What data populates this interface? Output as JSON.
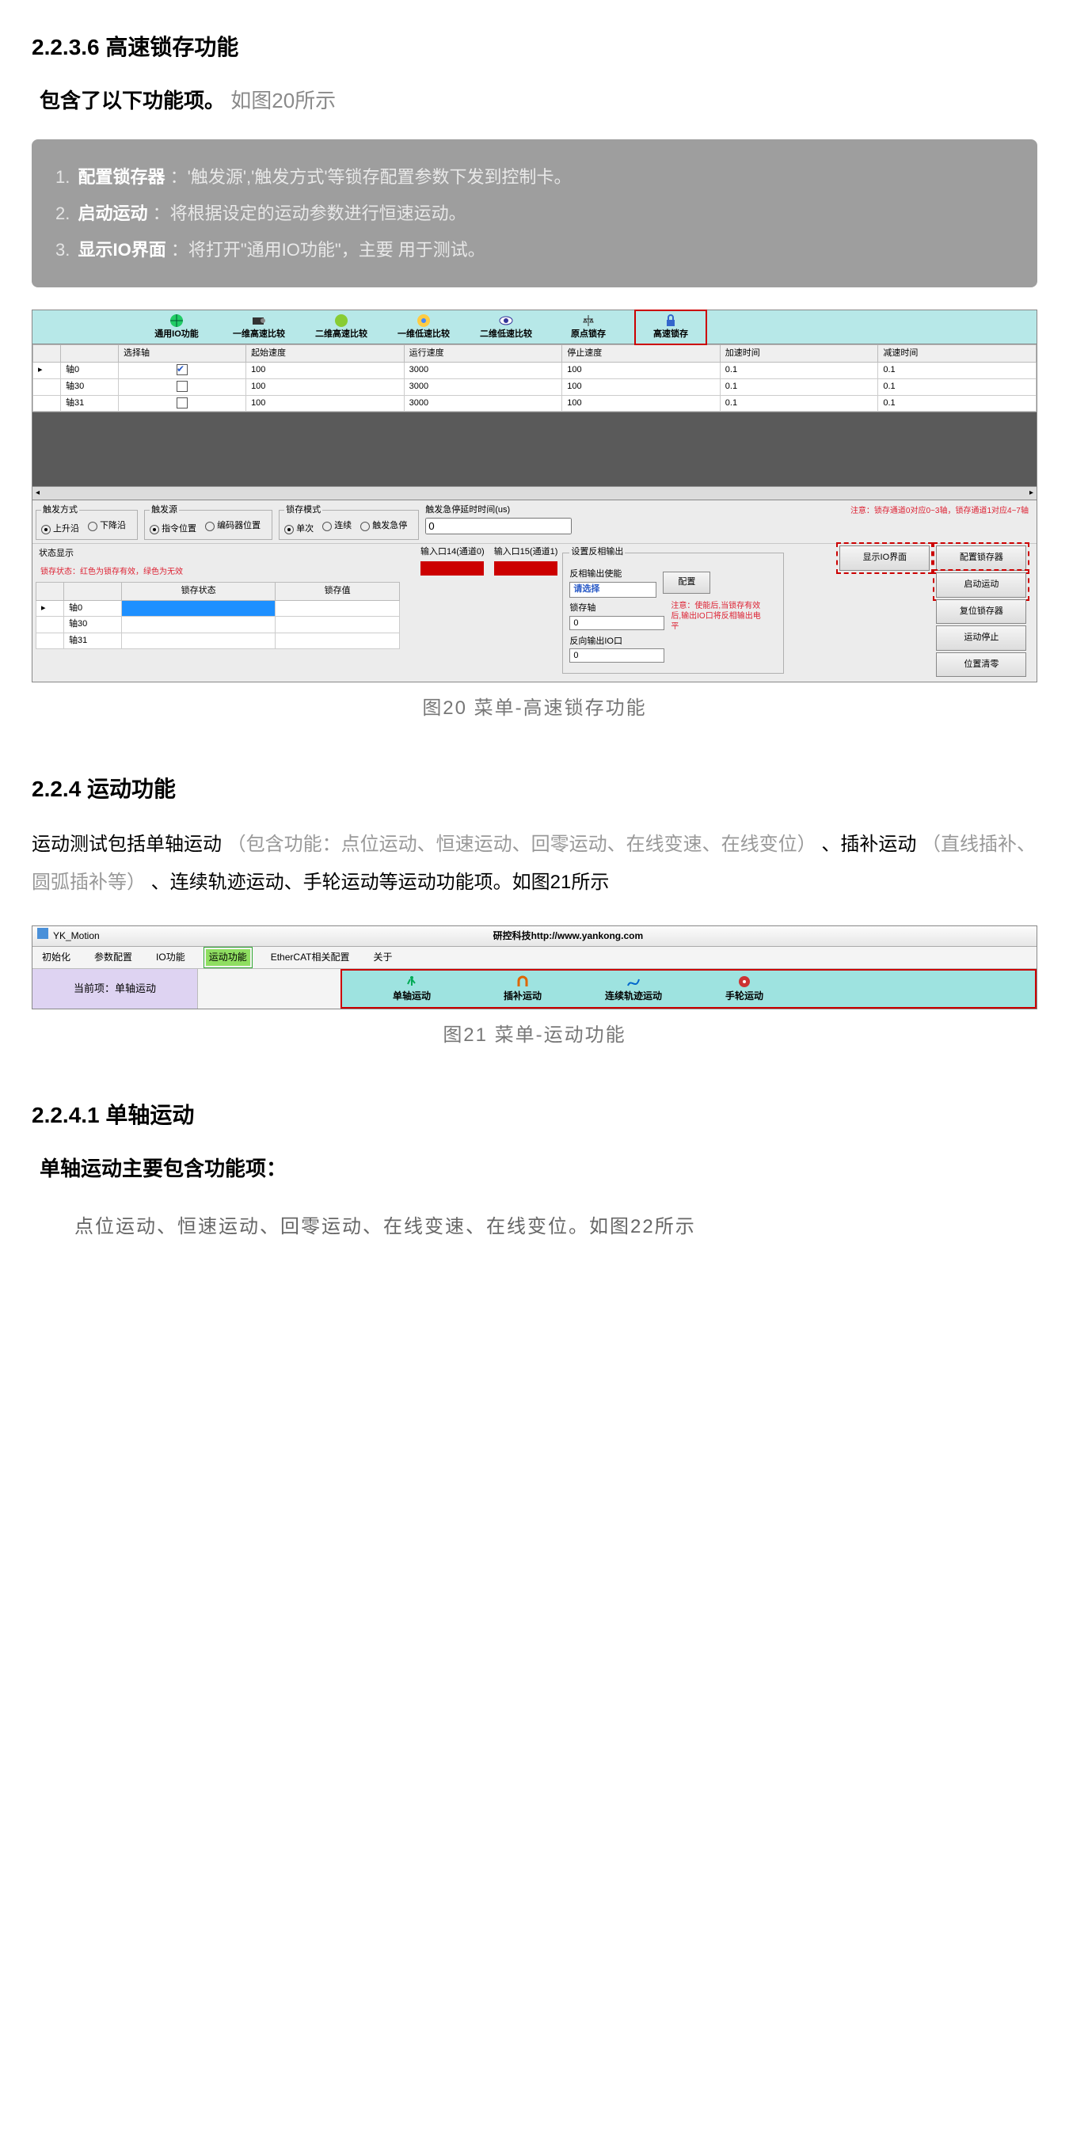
{
  "s2236": {
    "heading": "2.2.3.6 高速锁存功能",
    "intro_bold": "包含了以下功能项。",
    "intro_gray": "如图20所示",
    "callout": [
      {
        "num": "1.",
        "title": "配置锁存器",
        "desc": "：'触发源','触发方式'等锁存配置参数下发到控制卡。"
      },
      {
        "num": "2.",
        "title": "启动运动",
        "desc": "：将根据设定的运动参数进行恒速运动。"
      },
      {
        "num": "3.",
        "title": "显示IO界面",
        "desc": "：将打开\"通用IO功能\"，主要   用于测试。"
      }
    ]
  },
  "fig20": {
    "toolbar": [
      "通用IO功能",
      "一维高速比较",
      "二维高速比较",
      "一维低速比较",
      "二维低速比较",
      "原点锁存",
      "高速锁存"
    ],
    "grid_headers": [
      "",
      "选择轴",
      "起始速度",
      "运行速度",
      "停止速度",
      "加速时间",
      "减速时间"
    ],
    "grid_rows": [
      {
        "axis": "轴0",
        "sel": true,
        "v": [
          "100",
          "3000",
          "100",
          "0.1",
          "0.1"
        ]
      },
      {
        "axis": "轴30",
        "sel": false,
        "v": [
          "100",
          "3000",
          "100",
          "0.1",
          "0.1"
        ]
      },
      {
        "axis": "轴31",
        "sel": false,
        "v": [
          "100",
          "3000",
          "100",
          "0.1",
          "0.1"
        ]
      }
    ],
    "trig_mode_legend": "触发方式",
    "trig_mode": [
      "上升沿",
      "下降沿"
    ],
    "trig_src_legend": "触发源",
    "trig_src": [
      "指令位置",
      "编码器位置"
    ],
    "latch_mode_legend": "锁存模式",
    "latch_mode": [
      "单次",
      "连续",
      "触发急停"
    ],
    "estop_label": "触发急停延时时间(us)",
    "estop_val": "0",
    "status_title": "状态显示",
    "status_note": "锁存状态：红色为锁存有效，绿色为无效",
    "io_a": "输入口14(通道0)",
    "io_b": "输入口15(通道1)",
    "stat_headers": [
      "",
      "锁存状态",
      "锁存值"
    ],
    "stat_rows": [
      "轴0",
      "轴30",
      "轴31"
    ],
    "midbox_legend": "设置反相输出",
    "rev_enable_lbl": "反相输出使能",
    "rev_enable_val": "请选择",
    "btn_cfg": "配置",
    "latch_axis_lbl": "锁存轴",
    "latch_axis_val": "0",
    "rev_io_lbl": "反向输出IO口",
    "rev_io_val": "0",
    "mid_note": "注意：使能后,当锁存有效后,输出IO口将反相输出电平",
    "top_notice": "注意：锁存通道0对应0~3轴，锁存通道1对应4~7轴",
    "btn_showio": "显示IO界面",
    "btn_cfg_latch": "配置锁存器",
    "btn_start": "启动运动",
    "btn_reset": "复位锁存器",
    "btn_stop": "运动停止",
    "btn_clear": "位置清零",
    "caption": "图20 菜单-高速锁存功能"
  },
  "s224": {
    "heading": "2.2.4 运动功能",
    "para_pre": "运动测试包括单轴运动",
    "para_g1": "（包含功能：点位运动、恒速运动、回零运动、在线变速、在线变位）",
    "para_mid1": "、插补运动",
    "para_g2": "（直线插补、圆弧插补等）",
    "para_tail": "、连续轨迹运动、手轮运动等运动功能项。如图21所示"
  },
  "fig21": {
    "app_title": "YK_Motion",
    "header_text": "研控科技http://www.yankong.com",
    "menu": [
      "初始化",
      "参数配置",
      "IO功能",
      "运动功能",
      "EtherCAT相关配置",
      "关于"
    ],
    "menu_active_idx": 3,
    "current_label": "当前项：单轴运动",
    "tabs": [
      "单轴运动",
      "插补运动",
      "连续轨迹运动",
      "手轮运动"
    ],
    "caption": "图21 菜单-运动功能"
  },
  "s2241": {
    "heading": "2.2.4.1 单轴运动",
    "sub": "单轴运动主要包含功能项：",
    "body": "点位运动、恒速运动、回零运动、在线变速、在线变位。如图22所示"
  }
}
